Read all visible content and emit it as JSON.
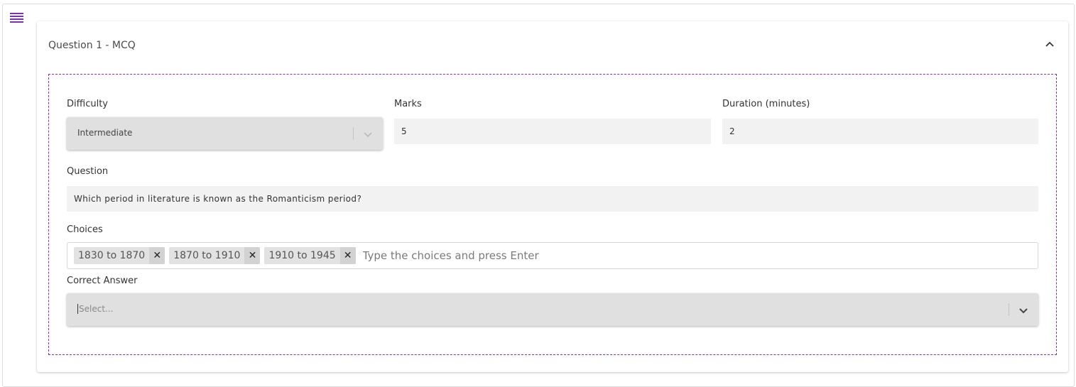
{
  "card": {
    "title": "Question 1 - MCQ"
  },
  "difficulty": {
    "label": "Difficulty",
    "value": "Intermediate"
  },
  "marks": {
    "label": "Marks",
    "value": "5"
  },
  "duration": {
    "label": "Duration (minutes)",
    "value": "2"
  },
  "question": {
    "label": "Question",
    "value": "Which period in literature is known as the Romanticism period?"
  },
  "choices": {
    "label": "Choices",
    "items": [
      "1830 to 1870",
      "1870 to 1910",
      "1910 to 1945"
    ],
    "remove_glyph": "✕",
    "placeholder": "Type the choices and press Enter"
  },
  "correct_answer": {
    "label": "Correct Answer",
    "placeholder": "Select..."
  },
  "icons": {
    "menu": "menu-icon",
    "collapse": "chevron-up-icon",
    "select_arrow": "chevron-down-icon"
  },
  "colors": {
    "accent": "#7b2fbf",
    "dashed_border": "#8a2bc2",
    "select_bg": "#e0e0e0",
    "input_bg": "#f2f2f2",
    "chip_bg": "#e2e2e2"
  }
}
